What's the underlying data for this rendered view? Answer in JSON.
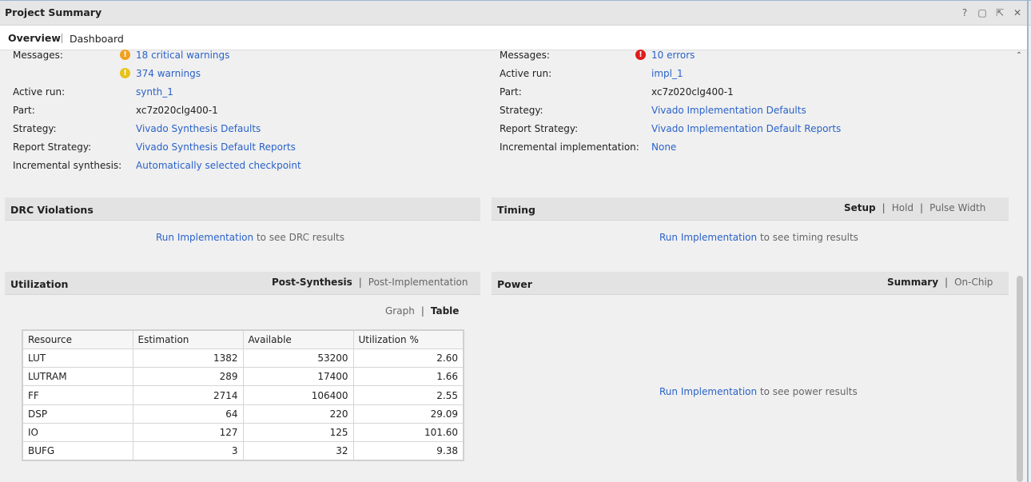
{
  "window": {
    "title": "Project Summary",
    "controls": [
      "?",
      "restore",
      "maximize",
      "float",
      "close"
    ]
  },
  "tabs": [
    {
      "label": "Overview",
      "active": true
    },
    {
      "label": "Dashboard",
      "active": false
    }
  ],
  "synthesis": {
    "messages_label": "Messages:",
    "critical_warnings": "18 critical warnings",
    "warnings": "374 warnings",
    "active_run_label": "Active run:",
    "active_run": "synth_1",
    "part_label": "Part:",
    "part": "xc7z020clg400-1",
    "strategy_label": "Strategy:",
    "strategy": "Vivado Synthesis Defaults",
    "report_strategy_label": "Report Strategy:",
    "report_strategy": "Vivado Synthesis Default Reports",
    "incremental_label": "Incremental synthesis:",
    "incremental": "Automatically selected checkpoint"
  },
  "implementation": {
    "messages_label": "Messages:",
    "errors": "10 errors",
    "active_run_label": "Active run:",
    "active_run": "impl_1",
    "part_label": "Part:",
    "part": "xc7z020clg400-1",
    "strategy_label": "Strategy:",
    "strategy": "Vivado Implementation Defaults",
    "report_strategy_label": "Report Strategy:",
    "report_strategy": "Vivado Implementation Default Reports",
    "incremental_label": "Incremental implementation:",
    "incremental": "None"
  },
  "drc": {
    "title": "DRC Violations",
    "link": "Run Implementation",
    "suffix": "to see DRC results"
  },
  "timing": {
    "title": "Timing",
    "subtabs": [
      "Setup",
      "Hold",
      "Pulse Width"
    ],
    "link": "Run Implementation",
    "suffix": "to see timing results"
  },
  "utilization": {
    "title": "Utilization",
    "subtabs": [
      "Post-Synthesis",
      "Post-Implementation"
    ],
    "view_toggle": [
      "Graph",
      "Table"
    ],
    "columns": [
      "Resource",
      "Estimation",
      "Available",
      "Utilization %"
    ],
    "rows": [
      [
        "LUT",
        "1382",
        "53200",
        "2.60"
      ],
      [
        "LUTRAM",
        "289",
        "17400",
        "1.66"
      ],
      [
        "FF",
        "2714",
        "106400",
        "2.55"
      ],
      [
        "DSP",
        "64",
        "220",
        "29.09"
      ],
      [
        "IO",
        "127",
        "125",
        "101.60"
      ],
      [
        "BUFG",
        "3",
        "32",
        "9.38"
      ]
    ]
  },
  "power": {
    "title": "Power",
    "subtabs": [
      "Summary",
      "On-Chip"
    ],
    "link": "Run Implementation",
    "suffix": "to see power results"
  }
}
